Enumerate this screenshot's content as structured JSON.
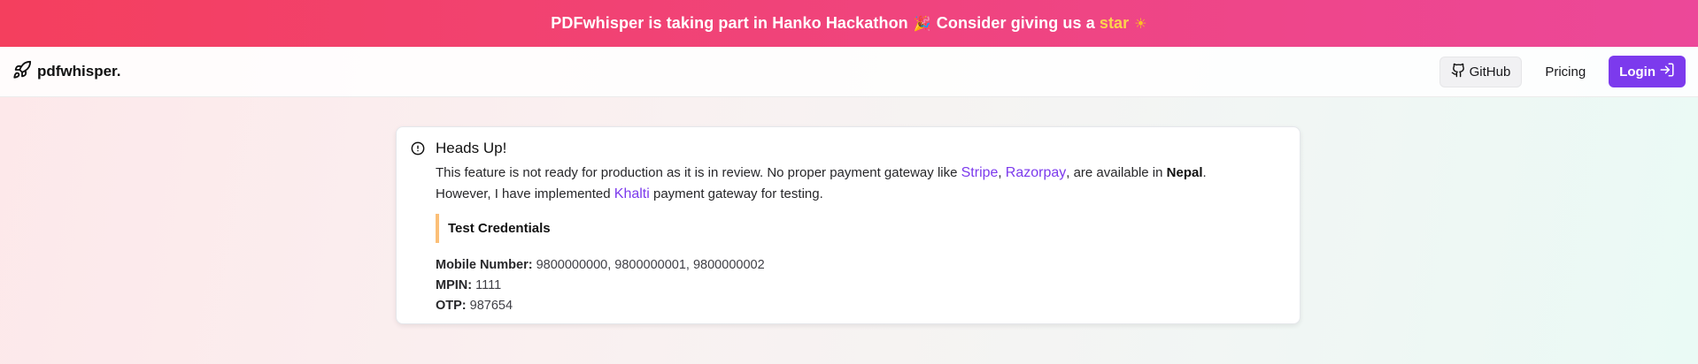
{
  "banner": {
    "text": "PDFwhisper is taking part in Hanko Hackathon",
    "party_emoji": "🎉",
    "cta_text": "Consider giving us a",
    "star_link": "star",
    "sun_emoji": "☀"
  },
  "navbar": {
    "brand": "pdfwhisper.",
    "github_label": "GitHub",
    "pricing_label": "Pricing",
    "login_label": "Login"
  },
  "alert": {
    "title": "Heads Up!",
    "line1_prefix": "This feature is not ready for production as it is in review. No proper payment gateway like",
    "link_stripe": "Stripe",
    "comma": ",",
    "link_razorpay": "Razorpay",
    "line1_mid": ", are available in",
    "country": "Nepal",
    "period": ".",
    "line2_prefix": "However, I have implemented",
    "link_khalti": "Khalti",
    "line2_suffix": "payment gateway for testing.",
    "quote_title": "Test Credentials",
    "credentials": {
      "mobile_label": "Mobile Number:",
      "mobile_value": "9800000000, 9800000001, 9800000002",
      "mpin_label": "MPIN:",
      "mpin_value": "1111",
      "otp_label": "OTP:",
      "otp_value": "987654"
    }
  },
  "colors": {
    "banner_start": "#f43f5e",
    "banner_end": "#ec4899",
    "accent": "#7c3aed",
    "star": "#fcd34d",
    "quote_border": "#fbbf77"
  },
  "icons": {
    "brand": "rocket-icon",
    "github": "github-icon",
    "login": "login-arrow-icon",
    "alert": "alert-circle-icon"
  }
}
